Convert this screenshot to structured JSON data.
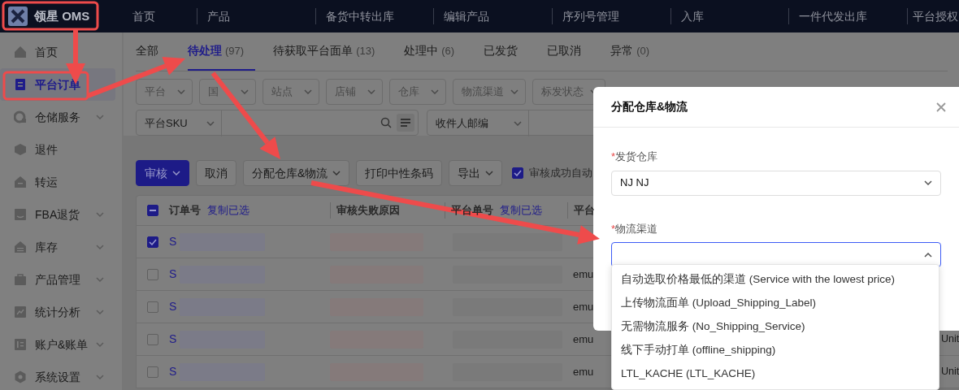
{
  "top_nav": {
    "logo": "领星 OMS",
    "items": [
      "首页",
      "产品",
      "备货中转出库",
      "编辑产品",
      "序列号管理",
      "入库",
      "一件代发出库",
      "平台授权"
    ]
  },
  "sidebar": {
    "items": [
      {
        "label": "首页",
        "expandable": false,
        "selected": false
      },
      {
        "label": "平台订单",
        "expandable": false,
        "selected": true
      },
      {
        "label": "仓储服务",
        "expandable": true,
        "selected": false
      },
      {
        "label": "退件",
        "expandable": false,
        "selected": false
      },
      {
        "label": "转运",
        "expandable": false,
        "selected": false
      },
      {
        "label": "FBA退货",
        "expandable": true,
        "selected": false
      },
      {
        "label": "库存",
        "expandable": true,
        "selected": false
      },
      {
        "label": "产品管理",
        "expandable": true,
        "selected": false
      },
      {
        "label": "统计分析",
        "expandable": true,
        "selected": false
      },
      {
        "label": "账户&账单",
        "expandable": true,
        "selected": false
      },
      {
        "label": "系统设置",
        "expandable": true,
        "selected": false
      }
    ]
  },
  "tabs": [
    {
      "label": "全部",
      "selected": false
    },
    {
      "label": "待处理",
      "count": "(97)",
      "selected": true
    },
    {
      "label": "待获取平台面单",
      "count": "(13)",
      "selected": false
    },
    {
      "label": "处理中",
      "count": "(6)",
      "selected": false
    },
    {
      "label": "已发货",
      "selected": false
    },
    {
      "label": "已取消",
      "selected": false
    },
    {
      "label": "异常",
      "count": "(0)",
      "selected": false
    }
  ],
  "filters": {
    "selects": [
      "平台",
      "国",
      "站点",
      "店铺",
      "仓库",
      "物流渠道",
      "标发状态"
    ],
    "searches": [
      {
        "field": "平台SKU",
        "kind": "search"
      },
      {
        "field": "收件人邮编",
        "kind": "plain"
      }
    ]
  },
  "toolbar": {
    "buttons": [
      {
        "label": "审核",
        "kind": "primary",
        "dropdown": true
      },
      {
        "label": "取消",
        "kind": "plain",
        "dropdown": false
      },
      {
        "label": "分配仓库&物流",
        "kind": "plain",
        "dropdown": true
      },
      {
        "label": "打印中性条码",
        "kind": "plain",
        "dropdown": false
      },
      {
        "label": "导出",
        "kind": "plain",
        "dropdown": true
      }
    ],
    "auto_option": {
      "label": "审核成功自动",
      "checked": true
    }
  },
  "table": {
    "select_all": {
      "indeterminate": true
    },
    "columns": [
      {
        "label": "订单号",
        "action": "复制已选"
      },
      {
        "label": "审核失败原因"
      },
      {
        "label": "平台单号",
        "action": "复制已选"
      },
      {
        "label": "平台"
      }
    ],
    "rows": [
      {
        "selected": true,
        "order_no": "S"
      },
      {
        "selected": false,
        "order_no": "S",
        "platform": "emu"
      },
      {
        "selected": false,
        "order_no": "S",
        "platform": "emu"
      },
      {
        "selected": false,
        "order_no": "S",
        "platform": "emu",
        "column_6": "Unit"
      },
      {
        "selected": false,
        "order_no": "S",
        "platform": "emu",
        "column_6": "Unit"
      }
    ]
  },
  "modal": {
    "title": "分配仓库&物流",
    "fields": [
      {
        "required_mark": "*",
        "label": "发货仓库",
        "value": "NJ NJ",
        "open": false
      },
      {
        "required_mark": "*",
        "label": "物流渠道",
        "open": true
      }
    ],
    "options": [
      "自动选取价格最低的渠道 (Service with the lowest price)",
      "上传物流面单 (Upload_Shipping_Label)",
      "无需物流服务 (No_Shipping_Service)",
      "线下手动打单 (offline_shipping)",
      "LTL_KACHE (LTL_KACHE)"
    ]
  }
}
